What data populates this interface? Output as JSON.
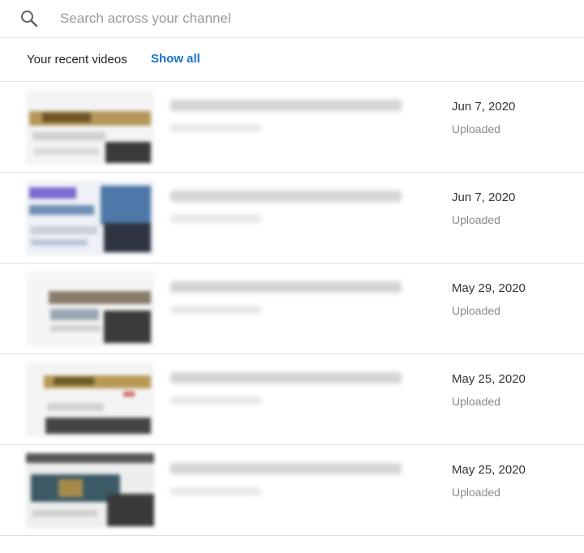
{
  "search": {
    "placeholder": "Search across your channel",
    "value": ""
  },
  "recent": {
    "title": "Your recent videos",
    "show_all_label": "Show all"
  },
  "videos": [
    {
      "date": "Jun 7, 2020",
      "status": "Uploaded"
    },
    {
      "date": "Jun 7, 2020",
      "status": "Uploaded"
    },
    {
      "date": "May 29, 2020",
      "status": "Uploaded"
    },
    {
      "date": "May 25, 2020",
      "status": "Uploaded"
    },
    {
      "date": "May 25, 2020",
      "status": "Uploaded"
    }
  ],
  "colors": {
    "link": "#1a73c8",
    "divider": "#e3e3e3",
    "secondary_text": "#8a8a8a"
  }
}
